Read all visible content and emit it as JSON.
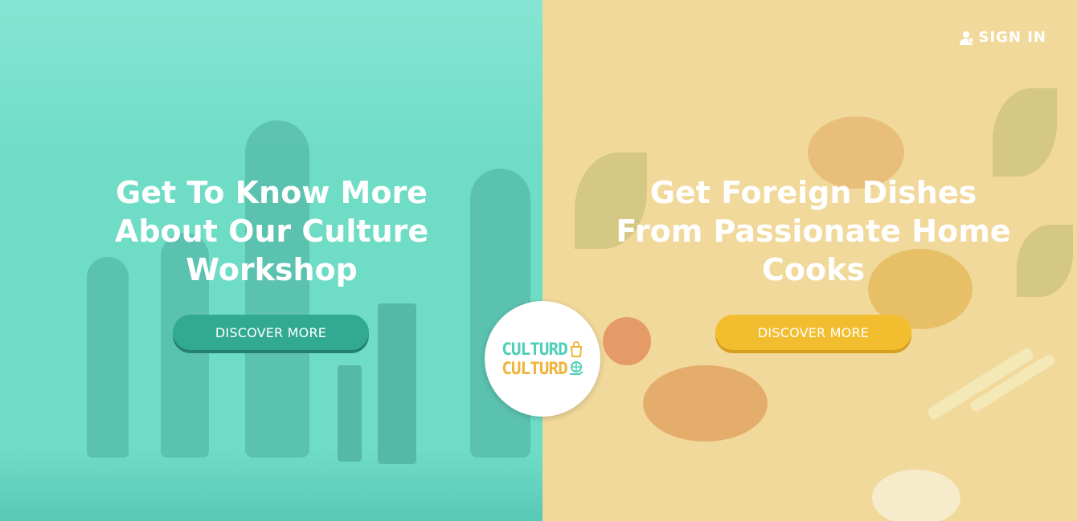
{
  "left": {
    "headline": [
      "Get To Know More",
      "About Our Culture",
      "Workshop"
    ],
    "button": "DISCOVER MORE"
  },
  "right": {
    "headline": [
      "Get Foreign Dishes",
      "From Passionate Home",
      "Cooks"
    ],
    "button": "DISCOVER MORE"
  },
  "header": {
    "signin_label": "SIGN IN",
    "signin_icon": "user-icon"
  },
  "logo": {
    "line1": "CULTURD",
    "line2": "CULTURD",
    "icon1": "bag-icon",
    "icon2": "globe-hand-icon"
  },
  "colors": {
    "left_overlay": "#6fdcc6",
    "right_overlay": "#f1d99b",
    "green_button": "#32a991",
    "yellow_button": "#f3bd30"
  }
}
